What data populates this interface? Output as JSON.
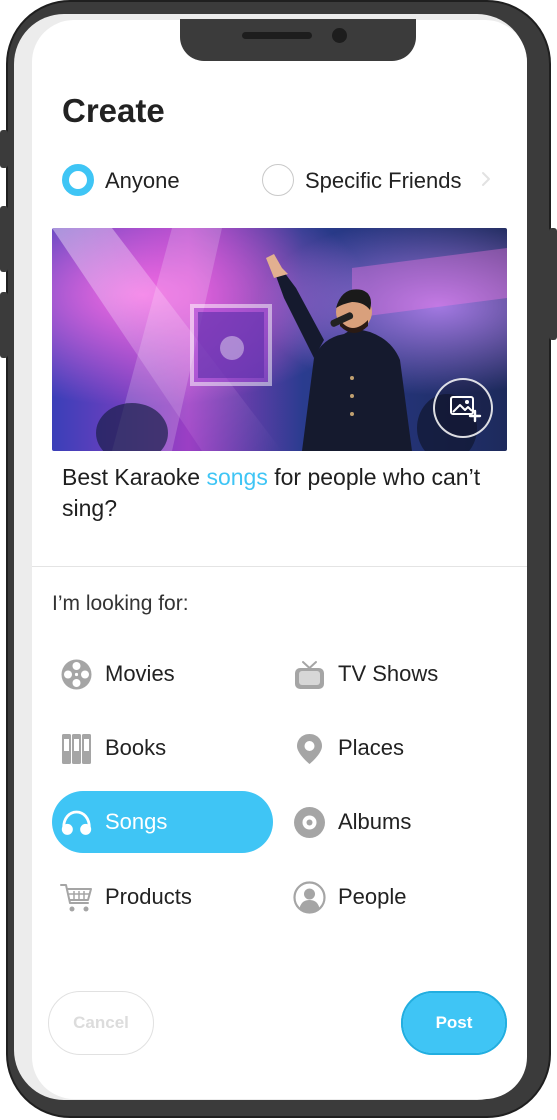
{
  "screen": {
    "title": "Create"
  },
  "audience": {
    "options": [
      {
        "label": "Anyone",
        "selected": true
      },
      {
        "label": "Specific Friends",
        "selected": false
      }
    ]
  },
  "post": {
    "question_before": "Best Karaoke ",
    "question_highlight": "songs",
    "question_after": " for people who can’t sing?"
  },
  "looking_for": {
    "prompt": "I’m looking for:",
    "categories": [
      {
        "label": "Movies",
        "icon": "film-reel-icon",
        "selected": false
      },
      {
        "label": "TV Shows",
        "icon": "tv-icon",
        "selected": false
      },
      {
        "label": "Books",
        "icon": "books-icon",
        "selected": false
      },
      {
        "label": "Places",
        "icon": "map-pin-icon",
        "selected": false
      },
      {
        "label": "Songs",
        "icon": "headphones-icon",
        "selected": true
      },
      {
        "label": "Albums",
        "icon": "vinyl-disc-icon",
        "selected": false
      },
      {
        "label": "Products",
        "icon": "shopping-cart-icon",
        "selected": false
      },
      {
        "label": "People",
        "icon": "person-icon",
        "selected": false
      }
    ]
  },
  "actions": {
    "cancel_label": "Cancel",
    "post_label": "Post"
  },
  "colors": {
    "accent": "#3fc5f5",
    "text": "#222222",
    "icon_gray": "#a5a5a5"
  }
}
